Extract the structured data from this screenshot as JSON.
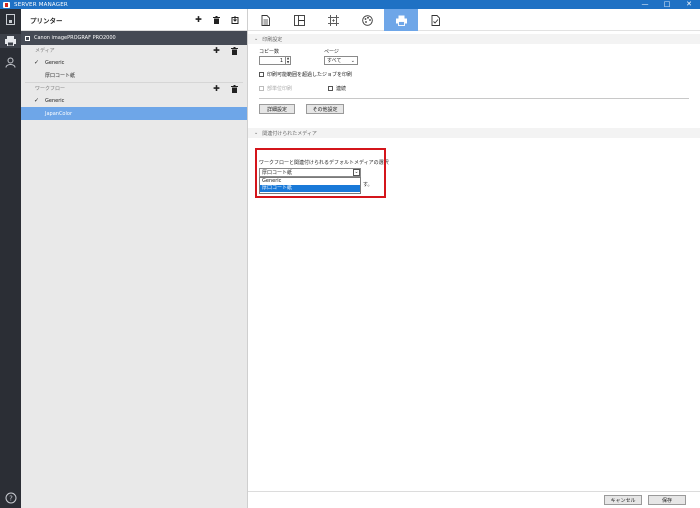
{
  "window": {
    "title": "SERVER MANAGER",
    "controls": [
      "—",
      "□",
      "✕"
    ]
  },
  "rail": {
    "items": [
      "printer-icon",
      "user-icon",
      "help-icon"
    ],
    "help_glyph": "?"
  },
  "sidebar": {
    "header": "プリンター",
    "printer_name": "Canon imagePROGRAF PRO2000",
    "media_section": "メディア",
    "media_items": [
      "Generic",
      "厚口コート紙"
    ],
    "workflow_section": "ワークフロー",
    "workflow_items": [
      "Generic",
      "JapanColor"
    ],
    "check_glyph": "✓",
    "selected_color": "#6ea6e8"
  },
  "main": {
    "tabs": [
      "document-icon",
      "layout-icon",
      "crop-icon",
      "color-palette-icon",
      "printer-icon",
      "checklist-icon"
    ],
    "active_tab_index": 4,
    "print_settings": {
      "heading": "印刷設定",
      "copies_label": "コピー数",
      "copies_value": "1",
      "page_label": "ページ",
      "page_value": "すべて",
      "check_exceed": "印刷可能範囲を超過したジョブを印刷",
      "check_partial": "部単位印刷",
      "check_continuous": "連続",
      "advanced_button": "詳細設定",
      "other_button": "その他設定"
    },
    "related_media": {
      "heading": "関連付けられたメディア",
      "select_label": "ワークフローと関連付けられるデフォルトメディアの選択",
      "selected_value": "厚口コート紙",
      "options": [
        "Generic",
        "厚口コート紙"
      ],
      "partial_text": "す。"
    },
    "footer": {
      "cancel": "キャンセル",
      "save": "保存"
    }
  }
}
